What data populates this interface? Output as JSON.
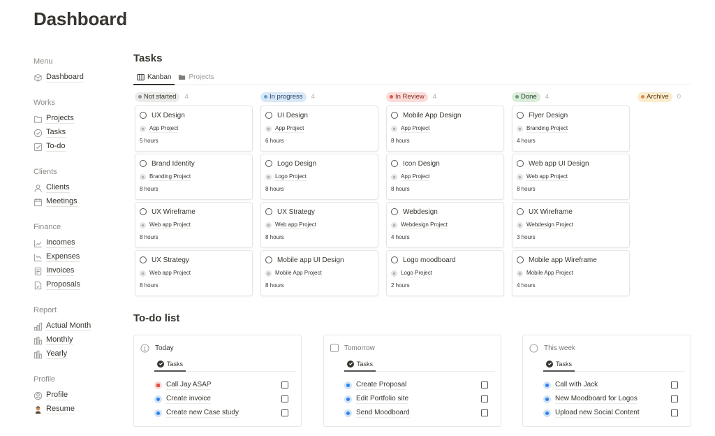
{
  "page": {
    "title": "Dashboard"
  },
  "sidebar": {
    "groups": [
      {
        "label": "Menu",
        "items": [
          {
            "label": "Dashboard",
            "icon": "cube-icon"
          }
        ]
      },
      {
        "label": "Works",
        "items": [
          {
            "label": "Projects",
            "icon": "folder-icon"
          },
          {
            "label": "Tasks",
            "icon": "check-circle-icon"
          },
          {
            "label": "To-do",
            "icon": "checkbox-icon"
          }
        ]
      },
      {
        "label": "Clients",
        "items": [
          {
            "label": "Clients",
            "icon": "person-icon"
          },
          {
            "label": "Meetings",
            "icon": "calendar-icon"
          }
        ]
      },
      {
        "label": "Finance",
        "items": [
          {
            "label": "Incomes",
            "icon": "trend-up-icon"
          },
          {
            "label": "Expenses",
            "icon": "trend-down-icon"
          },
          {
            "label": "Invoices",
            "icon": "document-icon"
          },
          {
            "label": "Proposals",
            "icon": "signed-document-icon"
          }
        ]
      },
      {
        "label": "Report",
        "items": [
          {
            "label": "Actual Month",
            "icon": "bar-chart-icon"
          },
          {
            "label": "Monthly",
            "icon": "bar-chart-icon"
          },
          {
            "label": "Yearly",
            "icon": "bar-chart-icon"
          }
        ]
      },
      {
        "label": "Profile",
        "items": [
          {
            "label": "Profile",
            "icon": "user-circle-icon"
          },
          {
            "label": "Resume",
            "icon": "person-emoji-icon"
          }
        ]
      }
    ]
  },
  "tasks": {
    "title": "Tasks",
    "tabs": [
      {
        "label": "Kanban",
        "icon": "columns-icon",
        "active": true
      },
      {
        "label": "Projects",
        "icon": "folder-filled-icon",
        "active": false
      }
    ],
    "columns": [
      {
        "status": "Not started",
        "count": "4",
        "pill_bg": "#ebebea",
        "dot": "#91918e",
        "text": "#37352f",
        "cards": [
          {
            "title": "UX Design",
            "project": "App Project",
            "hours": "5 hours"
          },
          {
            "title": "Brand Identity",
            "project": "Branding Project",
            "hours": "8 hours"
          },
          {
            "title": "UX Wireframe",
            "project": "Web app Project",
            "hours": "8 hours"
          },
          {
            "title": "UX Strategy",
            "project": "Web app Project",
            "hours": "8 hours"
          }
        ]
      },
      {
        "status": "In progress",
        "count": "4",
        "pill_bg": "#d9e8f5",
        "dot": "#5e9fd8",
        "text": "#28456c",
        "cards": [
          {
            "title": "UI Design",
            "project": "App Project",
            "hours": "6 hours"
          },
          {
            "title": "Logo Design",
            "project": "Logo Project",
            "hours": "8 hours"
          },
          {
            "title": "UX Strategy",
            "project": "Web app Project",
            "hours": "8 hours"
          },
          {
            "title": "Mobile app UI Design",
            "project": "Mobile App Project",
            "hours": "8 hours"
          }
        ]
      },
      {
        "status": "In Review",
        "count": "4",
        "pill_bg": "#fbdcd9",
        "dot": "#e0534a",
        "text": "#8a2a22",
        "cards": [
          {
            "title": "Mobile App Design",
            "project": "App Project",
            "hours": "8 hours"
          },
          {
            "title": "Icon Design",
            "project": "App Project",
            "hours": "8 hours"
          },
          {
            "title": "Webdesign",
            "project": "Webdesign Project",
            "hours": "4 hours"
          },
          {
            "title": "Logo moodboard",
            "project": "Logo Project",
            "hours": "2 hours"
          }
        ]
      },
      {
        "status": "Done",
        "count": "4",
        "pill_bg": "#dbeddb",
        "dot": "#6c9b7d",
        "text": "#1c3829",
        "cards": [
          {
            "title": "Flyer Design",
            "project": "Branding Project",
            "hours": "4 hours"
          },
          {
            "title": "Web app UI Design",
            "project": "Web app Project",
            "hours": "8 hours"
          },
          {
            "title": "UX Wireframe",
            "project": "Webdesign Project",
            "hours": "3 hours"
          },
          {
            "title": "Mobile app Wireframe",
            "project": "Mobile App Project",
            "hours": "4 hours"
          }
        ]
      },
      {
        "status": "Archive",
        "count": "0",
        "pill_bg": "#fbeccd",
        "dot": "#d9894a",
        "text": "#5a3a15",
        "cards": []
      }
    ]
  },
  "todo": {
    "title": "To-do list",
    "groups": [
      {
        "label": "Today",
        "icon": "alert-circle-icon",
        "tab": "Tasks",
        "items": [
          {
            "text": "Call Jay ASAP",
            "priority": "red",
            "checked": false
          },
          {
            "text": "Create invoice",
            "priority": "blue",
            "checked": false
          },
          {
            "text": "Create new Case study",
            "priority": "blue",
            "checked": false
          }
        ]
      },
      {
        "label": "Tomorrow",
        "icon": "square-icon",
        "tab": "Tasks",
        "items": [
          {
            "text": "Create Proposal",
            "priority": "blue",
            "checked": false
          },
          {
            "text": "Edit Portfolio site",
            "priority": "blue",
            "checked": false
          },
          {
            "text": "Send Moodboard",
            "priority": "blue",
            "checked": false
          }
        ]
      },
      {
        "label": "This week",
        "icon": "circle-icon",
        "tab": "Tasks",
        "items": [
          {
            "text": "Call with Jack",
            "priority": "blue",
            "checked": false
          },
          {
            "text": "New Moodboard for Logos",
            "priority": "blue",
            "checked": false
          },
          {
            "text": "Upload new Social Content",
            "priority": "blue",
            "checked": false
          }
        ]
      }
    ]
  }
}
